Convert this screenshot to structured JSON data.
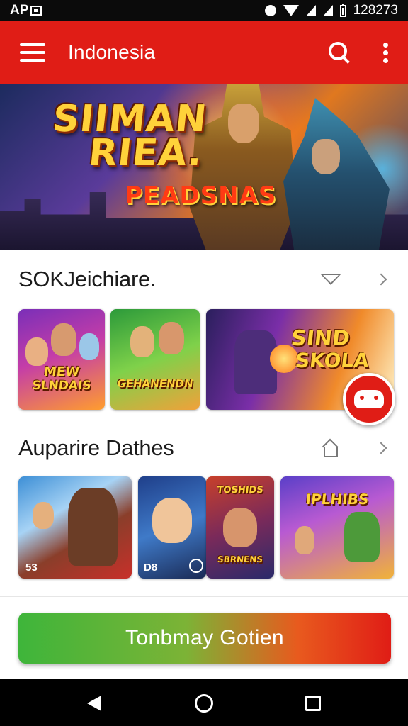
{
  "status_bar": {
    "left_text": "AP",
    "time": "128273"
  },
  "app_bar": {
    "title": "Indonesia"
  },
  "banner": {
    "title_line1": "SIIMAN",
    "title_line2": "RIEA.",
    "subtitle": "PEADSNAS"
  },
  "sections": [
    {
      "title": "SOKJeichiare.",
      "icon": "diamond-icon",
      "games": [
        {
          "label_line1": "MEW",
          "label_line2": "SLNDAIS"
        },
        {
          "label_line1": "GEHANENDN",
          "label_line2": ""
        },
        {
          "label_line1": "SIND",
          "label_line2": "SKOLA"
        }
      ]
    },
    {
      "title": "Auparire Dathes",
      "icon": "home-icon",
      "games": [
        {
          "badge": "53"
        },
        {
          "badge": "D8"
        },
        {
          "label_line1": "TOSHIDS",
          "label_line2": "SBRNENS"
        },
        {
          "label_line1": "IPLHIBS",
          "label_line2": ""
        }
      ]
    }
  ],
  "cta": {
    "label": "Tonbmay Gotien"
  },
  "colors": {
    "brand_red": "#e01d16",
    "cta_green": "#3eb53a"
  }
}
